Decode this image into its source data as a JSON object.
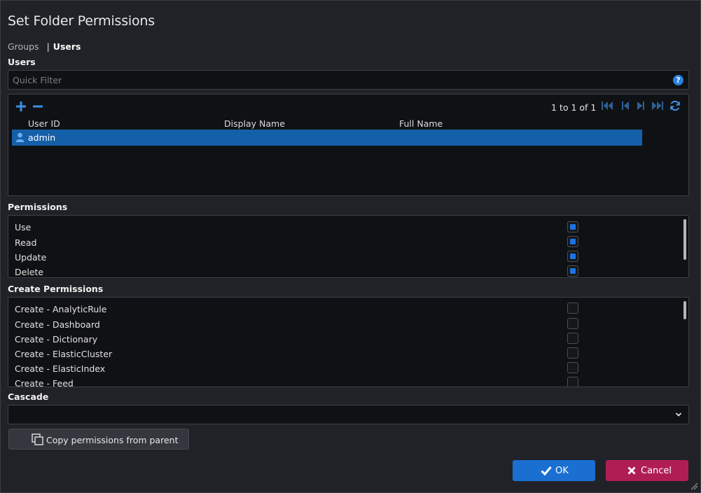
{
  "dialog": {
    "title": "Set Folder Permissions"
  },
  "tabs": {
    "groups": "Groups",
    "separator": "|",
    "users": "Users"
  },
  "users_section": {
    "label": "Users",
    "filter_placeholder": "Quick Filter",
    "help_icon": "?",
    "add_icon": "plus-icon",
    "remove_icon": "minus-icon",
    "pager_text": "1 to 1 of 1",
    "columns": [
      "User ID",
      "Display Name",
      "Full Name"
    ],
    "rows": [
      {
        "user_id": "admin",
        "display_name": "",
        "full_name": "",
        "selected": true
      }
    ]
  },
  "permissions_section": {
    "label": "Permissions",
    "items": [
      {
        "label": "Use",
        "checked": true
      },
      {
        "label": "Read",
        "checked": true
      },
      {
        "label": "Update",
        "checked": true
      },
      {
        "label": "Delete",
        "checked": true
      }
    ]
  },
  "create_permissions_section": {
    "label": "Create Permissions",
    "items": [
      {
        "label": "Create - AnalyticRule",
        "checked": false
      },
      {
        "label": "Create - Dashboard",
        "checked": false
      },
      {
        "label": "Create - Dictionary",
        "checked": false
      },
      {
        "label": "Create - ElasticCluster",
        "checked": false
      },
      {
        "label": "Create - ElasticIndex",
        "checked": false
      },
      {
        "label": "Create - Feed",
        "checked": false
      }
    ]
  },
  "cascade_section": {
    "label": "Cascade",
    "value": ""
  },
  "buttons": {
    "copy_label": "Copy permissions from parent",
    "ok_label": "OK",
    "cancel_label": "Cancel"
  },
  "colors": {
    "accent": "#1a6fd1",
    "danger": "#b01d55",
    "selection": "#1460a8",
    "background": "#202227"
  }
}
